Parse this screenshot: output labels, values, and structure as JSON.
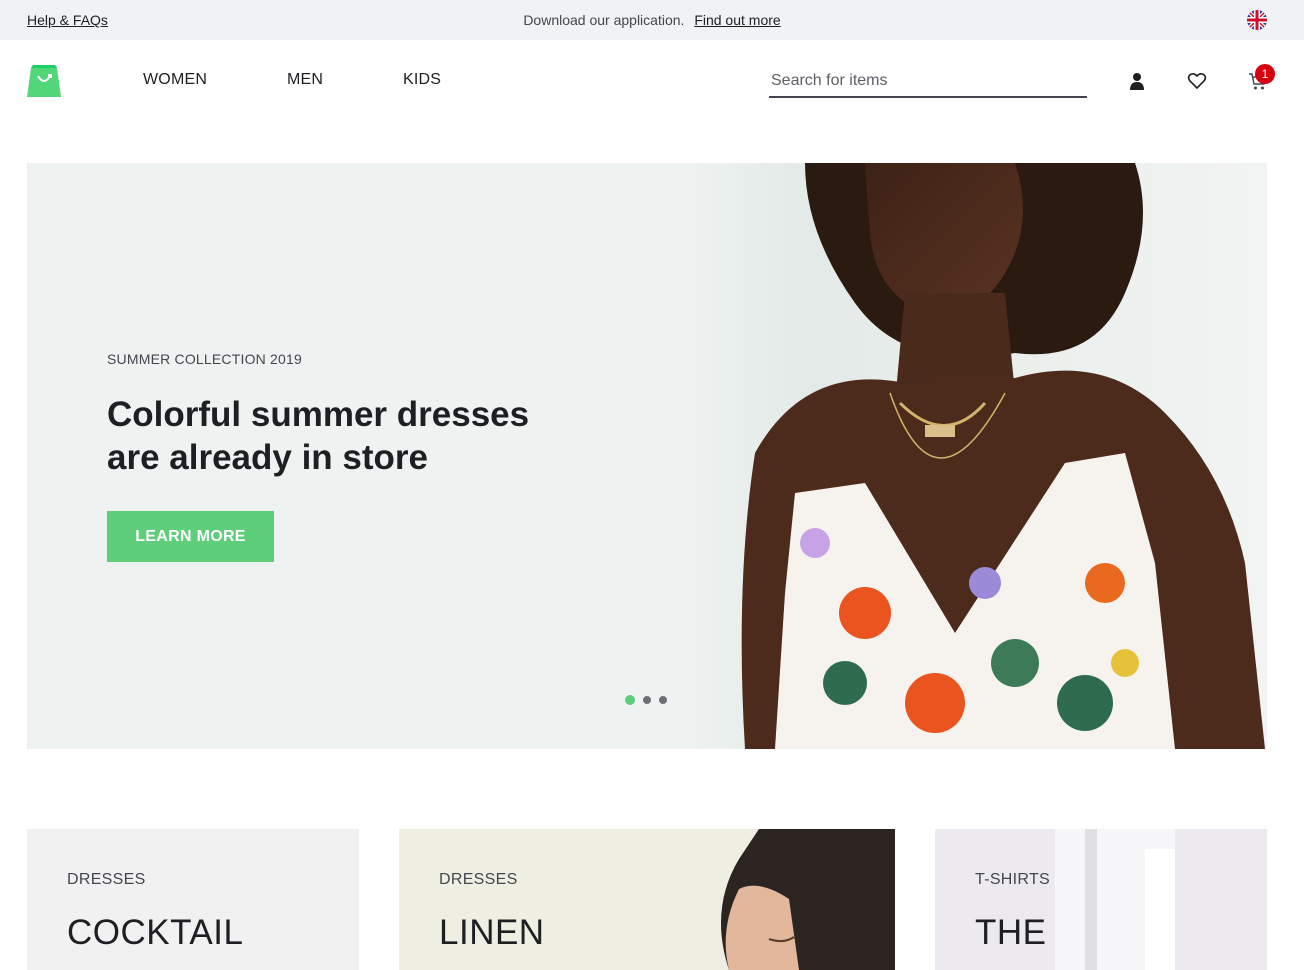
{
  "topbar": {
    "help_label": "Help & FAQs",
    "promo_text": "Download our application.",
    "promo_link": "Find out more",
    "language_icon": "uk-flag-icon"
  },
  "header": {
    "logo_icon": "shopping-bag-logo-icon",
    "nav": [
      {
        "label": "WOMEN"
      },
      {
        "label": "MEN"
      },
      {
        "label": "KIDS"
      }
    ],
    "search": {
      "placeholder": "Search for items",
      "value": ""
    },
    "icons": [
      "user-icon",
      "heart-icon",
      "cart-icon"
    ],
    "cart_count": "1"
  },
  "hero": {
    "kicker": "SUMMER COLLECTION 2019",
    "title_line1": "Colorful summer dresses",
    "title_line2": "are already in store",
    "button_label": "LEARN MORE",
    "slides_total": 3,
    "active_slide": 1
  },
  "cards": [
    {
      "kicker": "DRESSES",
      "title": "COCKTAIL"
    },
    {
      "kicker": "DRESSES",
      "title": "LINEN"
    },
    {
      "kicker": "T-SHIRTS",
      "title": "THE"
    }
  ],
  "colors": {
    "accent": "#5ece7b",
    "badge": "#d9000d",
    "text": "#1d1f22",
    "topbar_bg": "#f1f2f3",
    "hero_bg": "#eef3f1"
  }
}
